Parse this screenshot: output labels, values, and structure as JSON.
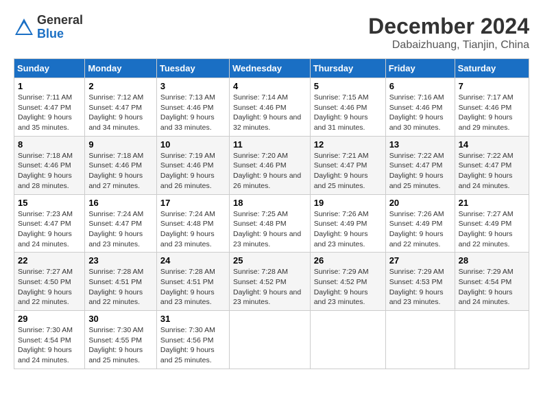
{
  "header": {
    "logo_general": "General",
    "logo_blue": "Blue",
    "month_title": "December 2024",
    "location": "Dabaizhuang, Tianjin, China"
  },
  "weekdays": [
    "Sunday",
    "Monday",
    "Tuesday",
    "Wednesday",
    "Thursday",
    "Friday",
    "Saturday"
  ],
  "weeks": [
    [
      {
        "day": "1",
        "sunrise": "7:11 AM",
        "sunset": "4:47 PM",
        "daylight": "9 hours and 35 minutes."
      },
      {
        "day": "2",
        "sunrise": "7:12 AM",
        "sunset": "4:47 PM",
        "daylight": "9 hours and 34 minutes."
      },
      {
        "day": "3",
        "sunrise": "7:13 AM",
        "sunset": "4:46 PM",
        "daylight": "9 hours and 33 minutes."
      },
      {
        "day": "4",
        "sunrise": "7:14 AM",
        "sunset": "4:46 PM",
        "daylight": "9 hours and 32 minutes."
      },
      {
        "day": "5",
        "sunrise": "7:15 AM",
        "sunset": "4:46 PM",
        "daylight": "9 hours and 31 minutes."
      },
      {
        "day": "6",
        "sunrise": "7:16 AM",
        "sunset": "4:46 PM",
        "daylight": "9 hours and 30 minutes."
      },
      {
        "day": "7",
        "sunrise": "7:17 AM",
        "sunset": "4:46 PM",
        "daylight": "9 hours and 29 minutes."
      }
    ],
    [
      {
        "day": "8",
        "sunrise": "7:18 AM",
        "sunset": "4:46 PM",
        "daylight": "9 hours and 28 minutes."
      },
      {
        "day": "9",
        "sunrise": "7:18 AM",
        "sunset": "4:46 PM",
        "daylight": "9 hours and 27 minutes."
      },
      {
        "day": "10",
        "sunrise": "7:19 AM",
        "sunset": "4:46 PM",
        "daylight": "9 hours and 26 minutes."
      },
      {
        "day": "11",
        "sunrise": "7:20 AM",
        "sunset": "4:46 PM",
        "daylight": "9 hours and 26 minutes."
      },
      {
        "day": "12",
        "sunrise": "7:21 AM",
        "sunset": "4:47 PM",
        "daylight": "9 hours and 25 minutes."
      },
      {
        "day": "13",
        "sunrise": "7:22 AM",
        "sunset": "4:47 PM",
        "daylight": "9 hours and 25 minutes."
      },
      {
        "day": "14",
        "sunrise": "7:22 AM",
        "sunset": "4:47 PM",
        "daylight": "9 hours and 24 minutes."
      }
    ],
    [
      {
        "day": "15",
        "sunrise": "7:23 AM",
        "sunset": "4:47 PM",
        "daylight": "9 hours and 24 minutes."
      },
      {
        "day": "16",
        "sunrise": "7:24 AM",
        "sunset": "4:47 PM",
        "daylight": "9 hours and 23 minutes."
      },
      {
        "day": "17",
        "sunrise": "7:24 AM",
        "sunset": "4:48 PM",
        "daylight": "9 hours and 23 minutes."
      },
      {
        "day": "18",
        "sunrise": "7:25 AM",
        "sunset": "4:48 PM",
        "daylight": "9 hours and 23 minutes."
      },
      {
        "day": "19",
        "sunrise": "7:26 AM",
        "sunset": "4:49 PM",
        "daylight": "9 hours and 23 minutes."
      },
      {
        "day": "20",
        "sunrise": "7:26 AM",
        "sunset": "4:49 PM",
        "daylight": "9 hours and 22 minutes."
      },
      {
        "day": "21",
        "sunrise": "7:27 AM",
        "sunset": "4:49 PM",
        "daylight": "9 hours and 22 minutes."
      }
    ],
    [
      {
        "day": "22",
        "sunrise": "7:27 AM",
        "sunset": "4:50 PM",
        "daylight": "9 hours and 22 minutes."
      },
      {
        "day": "23",
        "sunrise": "7:28 AM",
        "sunset": "4:51 PM",
        "daylight": "9 hours and 22 minutes."
      },
      {
        "day": "24",
        "sunrise": "7:28 AM",
        "sunset": "4:51 PM",
        "daylight": "9 hours and 23 minutes."
      },
      {
        "day": "25",
        "sunrise": "7:28 AM",
        "sunset": "4:52 PM",
        "daylight": "9 hours and 23 minutes."
      },
      {
        "day": "26",
        "sunrise": "7:29 AM",
        "sunset": "4:52 PM",
        "daylight": "9 hours and 23 minutes."
      },
      {
        "day": "27",
        "sunrise": "7:29 AM",
        "sunset": "4:53 PM",
        "daylight": "9 hours and 23 minutes."
      },
      {
        "day": "28",
        "sunrise": "7:29 AM",
        "sunset": "4:54 PM",
        "daylight": "9 hours and 24 minutes."
      }
    ],
    [
      {
        "day": "29",
        "sunrise": "7:30 AM",
        "sunset": "4:54 PM",
        "daylight": "9 hours and 24 minutes."
      },
      {
        "day": "30",
        "sunrise": "7:30 AM",
        "sunset": "4:55 PM",
        "daylight": "9 hours and 25 minutes."
      },
      {
        "day": "31",
        "sunrise": "7:30 AM",
        "sunset": "4:56 PM",
        "daylight": "9 hours and 25 minutes."
      },
      null,
      null,
      null,
      null
    ]
  ],
  "labels": {
    "sunrise": "Sunrise:",
    "sunset": "Sunset:",
    "daylight": "Daylight:"
  }
}
